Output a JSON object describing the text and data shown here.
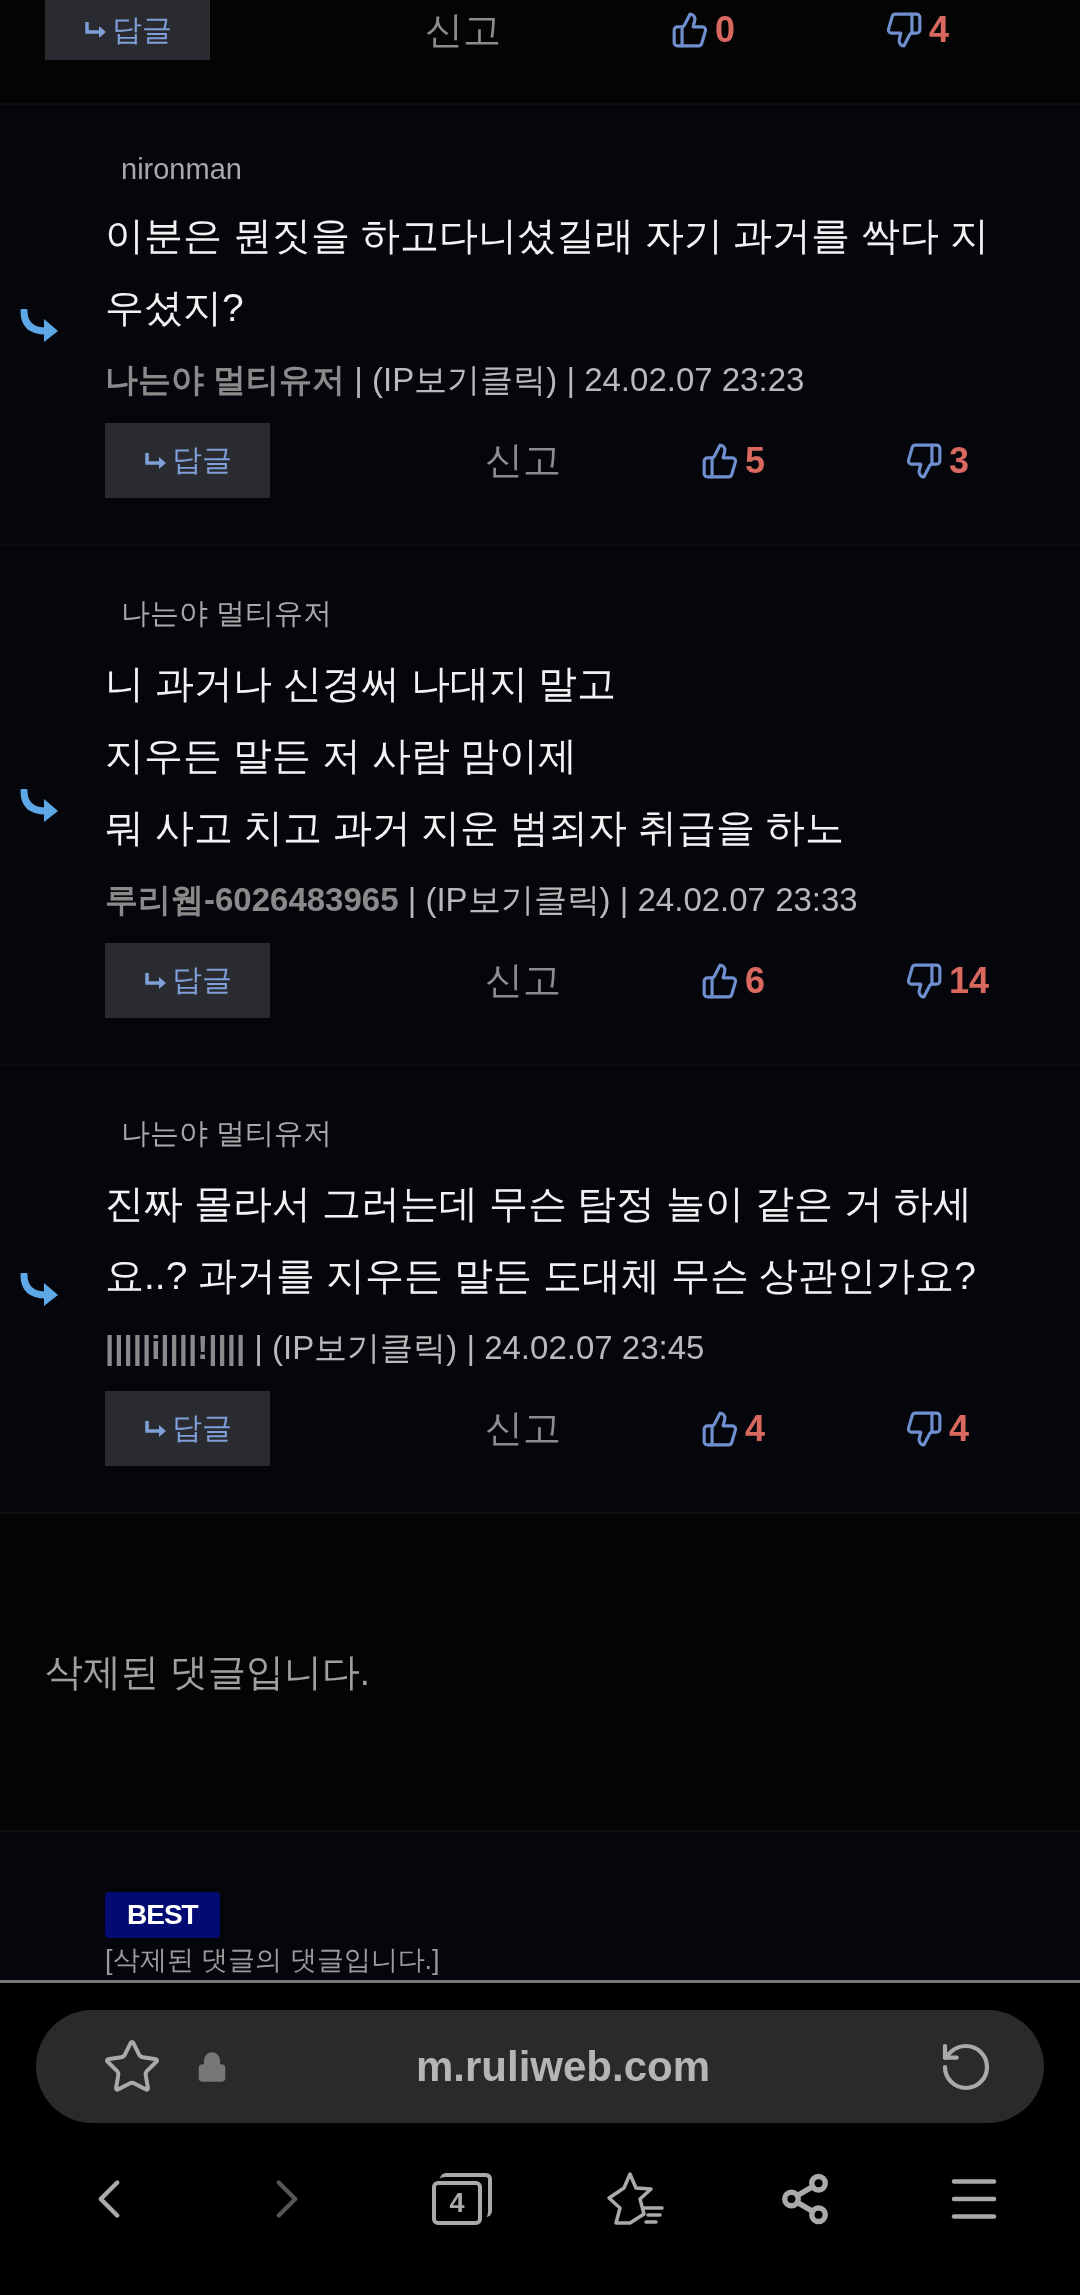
{
  "top_actions": {
    "reply": "답글",
    "report": "신고",
    "likes": "0",
    "dislikes": "4"
  },
  "comments": [
    {
      "reply_to": "nironman",
      "lines": [
        "이분은 뭔짓을 하고다니셨길래 자기 과거를 싹다 지우셨지?"
      ],
      "meta": "**나는야 멀티유저** | (IP보기클릭) | 24.02.07 23:23",
      "reply": "답글",
      "report": "신고",
      "likes": "5",
      "dislikes": "3"
    },
    {
      "reply_to": "나는야 멀티유저",
      "lines": [
        "니 과거나 신경써 나대지 말고",
        "지우든 말든 저 사람 맘이제",
        "뭐 사고 치고 과거 지운 범죄자 취급을 하노"
      ],
      "meta": "**루리웹-6026483965** | (IP보기클릭) | 24.02.07 23:33",
      "reply": "답글",
      "report": "신고",
      "likes": "6",
      "dislikes": "14"
    },
    {
      "reply_to": "나는야 멀티유저",
      "lines": [
        "진짜 몰라서 그러는데 무슨 탐정 놀이 같은 거 하세요..? 과거를 지우든 말든 도대체 무슨 상관인가요?"
      ],
      "meta": "**|||||i||||!||||** | (IP보기클릭) | 24.02.07 23:45",
      "reply": "답글",
      "report": "신고",
      "likes": "4",
      "dislikes": "4"
    }
  ],
  "deleted_comment": "삭제된 댓글입니다.",
  "best_comment": {
    "badge": "BEST",
    "text": "[삭제된 댓글의 댓글입니다.]"
  },
  "browser": {
    "url": "m.ruliweb.com",
    "tab_count": "4",
    "back_disabled": false,
    "forward_disabled": true
  }
}
